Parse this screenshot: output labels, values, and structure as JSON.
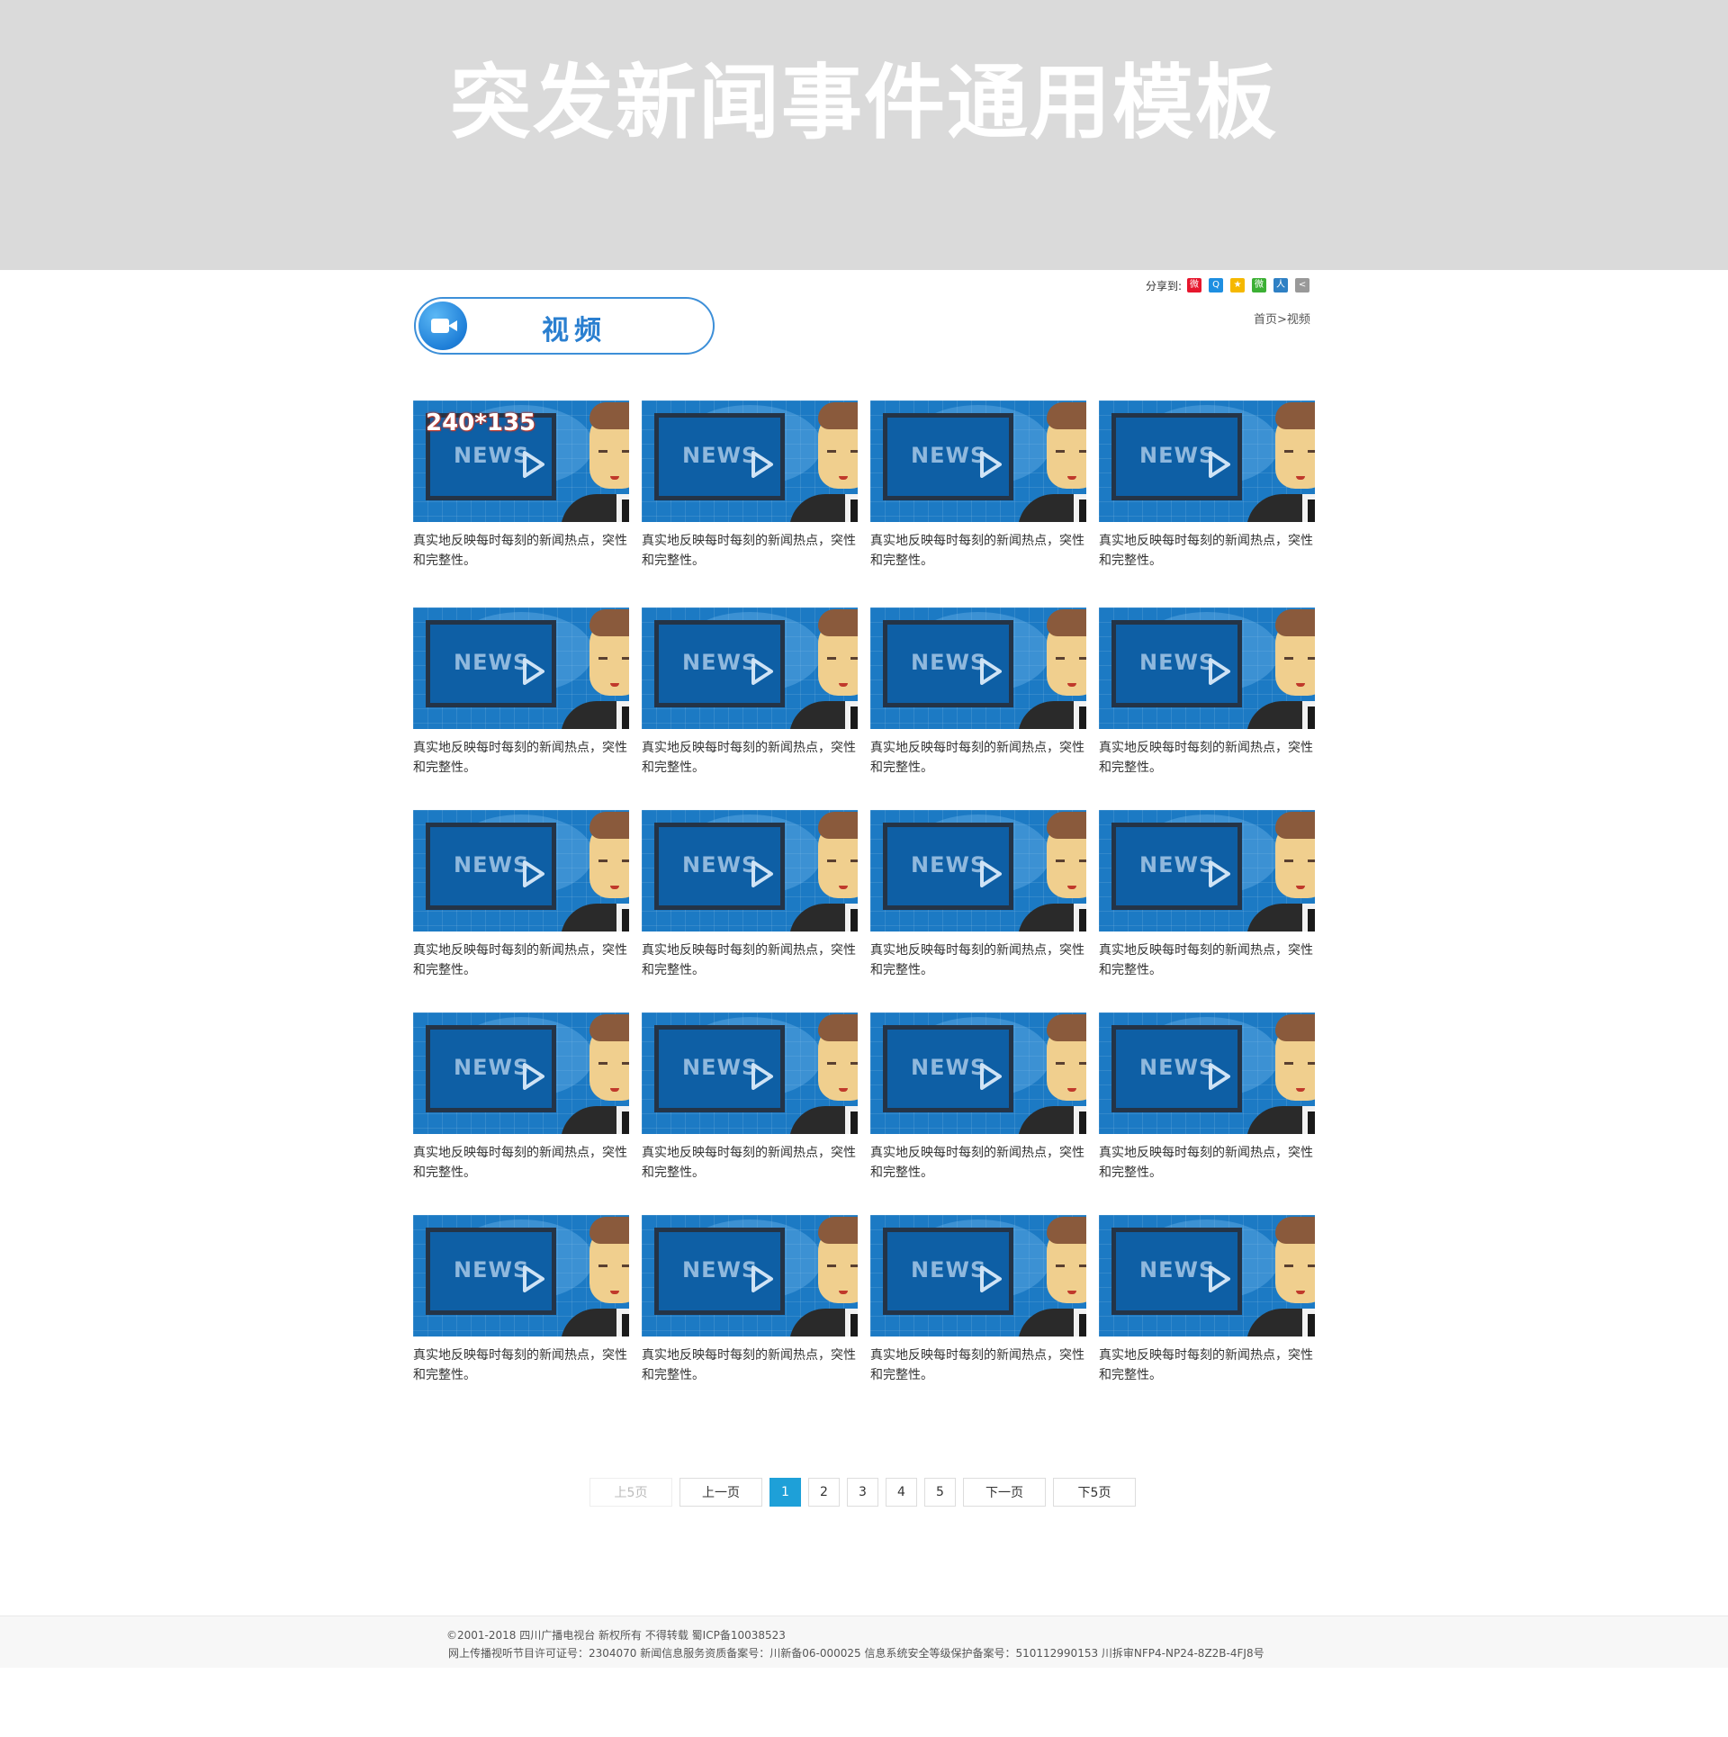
{
  "banner": {
    "title": "突发新闻事件通用模板"
  },
  "share": {
    "label": "分享到:",
    "icons": [
      {
        "name": "weibo-icon",
        "color": "#e6162d",
        "glyph": "微"
      },
      {
        "name": "qq-icon",
        "color": "#1e8fe1",
        "glyph": "Q"
      },
      {
        "name": "qzone-icon",
        "color": "#f5b800",
        "glyph": "★"
      },
      {
        "name": "wechat-icon",
        "color": "#3cb034",
        "glyph": "微"
      },
      {
        "name": "renren-icon",
        "color": "#2f80c4",
        "glyph": "人"
      },
      {
        "name": "more-share-icon",
        "color": "#999999",
        "glyph": "<"
      }
    ]
  },
  "section": {
    "label": "视频",
    "icon": "video-camera-icon"
  },
  "breadcrumb": {
    "home": "首页",
    "separator": ">",
    "current": "视频"
  },
  "videos": {
    "size_badge": "240*135",
    "screen_text": "NEWS",
    "items": [
      {
        "caption": "真实地反映每时每刻的新闻热点，突性和完整性。"
      },
      {
        "caption": "真实地反映每时每刻的新闻热点，突性和完整性。"
      },
      {
        "caption": "真实地反映每时每刻的新闻热点，突性和完整性。"
      },
      {
        "caption": "真实地反映每时每刻的新闻热点，突性和完整性。"
      },
      {
        "caption": "真实地反映每时每刻的新闻热点，突性和完整性。"
      },
      {
        "caption": "真实地反映每时每刻的新闻热点，突性和完整性。"
      },
      {
        "caption": "真实地反映每时每刻的新闻热点，突性和完整性。"
      },
      {
        "caption": "真实地反映每时每刻的新闻热点，突性和完整性。"
      },
      {
        "caption": "真实地反映每时每刻的新闻热点，突性和完整性。"
      },
      {
        "caption": "真实地反映每时每刻的新闻热点，突性和完整性。"
      },
      {
        "caption": "真实地反映每时每刻的新闻热点，突性和完整性。"
      },
      {
        "caption": "真实地反映每时每刻的新闻热点，突性和完整性。"
      },
      {
        "caption": "真实地反映每时每刻的新闻热点，突性和完整性。"
      },
      {
        "caption": "真实地反映每时每刻的新闻热点，突性和完整性。"
      },
      {
        "caption": "真实地反映每时每刻的新闻热点，突性和完整性。"
      },
      {
        "caption": "真实地反映每时每刻的新闻热点，突性和完整性。"
      },
      {
        "caption": "真实地反映每时每刻的新闻热点，突性和完整性。"
      },
      {
        "caption": "真实地反映每时每刻的新闻热点，突性和完整性。"
      },
      {
        "caption": "真实地反映每时每刻的新闻热点，突性和完整性。"
      },
      {
        "caption": "真实地反映每时每刻的新闻热点，突性和完整性。"
      }
    ]
  },
  "pagination": {
    "prev5": "上5页",
    "prev": "上一页",
    "pages": [
      "1",
      "2",
      "3",
      "4",
      "5"
    ],
    "current_page": "1",
    "next": "下一页",
    "next5": "下5页"
  },
  "footer": {
    "line1": "©2001-2018 四川广播电视台 新权所有 不得转载   蜀ICP备10038523",
    "line2": "网上传播视听节目许可证号：2304070    新闻信息服务资质备案号：川新备06-000025    信息系统安全等级保护备案号：510112990153    川拆审NFP4-NP24-8Z2B-4FJ8号"
  },
  "colors": {
    "banner_bg": "#dadada",
    "accent_blue": "#2a7fd0",
    "pager_active": "#1ea0d8",
    "thumb_bg": "#1c7ac4"
  }
}
